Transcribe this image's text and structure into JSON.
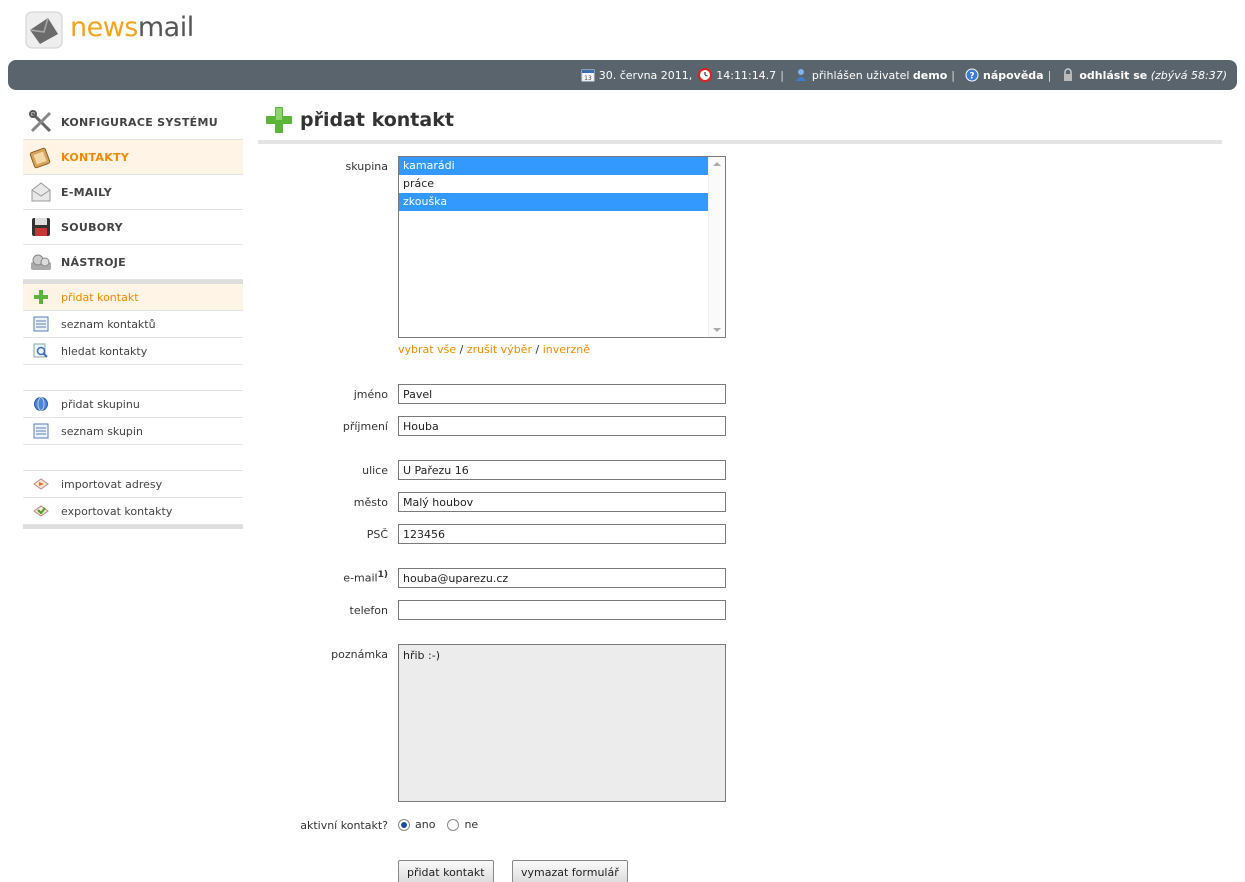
{
  "logo": {
    "part1": "news",
    "part2": "mail"
  },
  "topbar": {
    "date": "30. června 2011,",
    "time": "14:11:14.7",
    "logged_prefix": "přihlášen uživatel",
    "user": "demo",
    "help": "nápověda",
    "logout": "odhlásit se",
    "remaining": "(zbývá 58:37)"
  },
  "sidebar": {
    "main": [
      {
        "label": "KONFIGURACE SYSTÉMU",
        "icon": "tools-icon"
      },
      {
        "label": "KONTAKTY",
        "icon": "address-book-icon"
      },
      {
        "label": "E-MAILY",
        "icon": "envelope-icon"
      },
      {
        "label": "SOUBORY",
        "icon": "floppy-disk-icon"
      },
      {
        "label": "NÁSTROJE",
        "icon": "gears-icon"
      }
    ],
    "sub": [
      {
        "label": "přidat kontakt",
        "icon": "plus-icon"
      },
      {
        "label": "seznam kontaktů",
        "icon": "list-icon"
      },
      {
        "label": "hledat kontakty",
        "icon": "magnifier-icon"
      },
      {
        "label": "přidat skupinu",
        "icon": "globe-icon"
      },
      {
        "label": "seznam skupin",
        "icon": "list-icon"
      },
      {
        "label": "importovat adresy",
        "icon": "import-icon"
      },
      {
        "label": "exportovat kontakty",
        "icon": "export-icon"
      }
    ]
  },
  "page": {
    "title": "přidat kontakt"
  },
  "form": {
    "group_label": "skupina",
    "groups": [
      {
        "label": "kamarádi",
        "selected": true
      },
      {
        "label": "práce",
        "selected": false
      },
      {
        "label": "zkouška",
        "selected": true
      }
    ],
    "select_all": "vybrat vše",
    "clear_selection": "zrušit výběr",
    "invert": "inverzně",
    "slash": "/",
    "first_name_label": "jméno",
    "first_name": "Pavel",
    "last_name_label": "příjmení",
    "last_name": "Houba",
    "street_label": "ulice",
    "street": "U Pařezu 16",
    "city_label": "město",
    "city": "Malý houbov",
    "zip_label": "PSČ",
    "zip": "123456",
    "email_label": "e-mail",
    "email_sup": "1)",
    "email": "houba@uparezu.cz",
    "phone_label": "telefon",
    "phone": "",
    "note_label": "poznámka",
    "note": "hřib :-)",
    "active_label": "aktivní kontakt?",
    "active_yes": "ano",
    "active_no": "ne",
    "submit": "přidat kontakt",
    "reset": "vymazat formulář"
  }
}
